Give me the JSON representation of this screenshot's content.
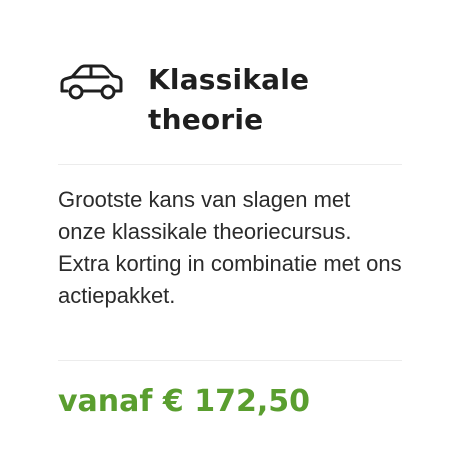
{
  "card": {
    "icon": "car-icon",
    "title": "Klassikale theorie",
    "description": "Grootste kans van slagen met onze klassikale theoriecursus. Extra korting in combinatie met ons actiepakket.",
    "price": "vanaf € 172,50"
  },
  "colors": {
    "price": "#5a9e2f",
    "text": "#2b2b2b",
    "divider": "#ececec"
  }
}
